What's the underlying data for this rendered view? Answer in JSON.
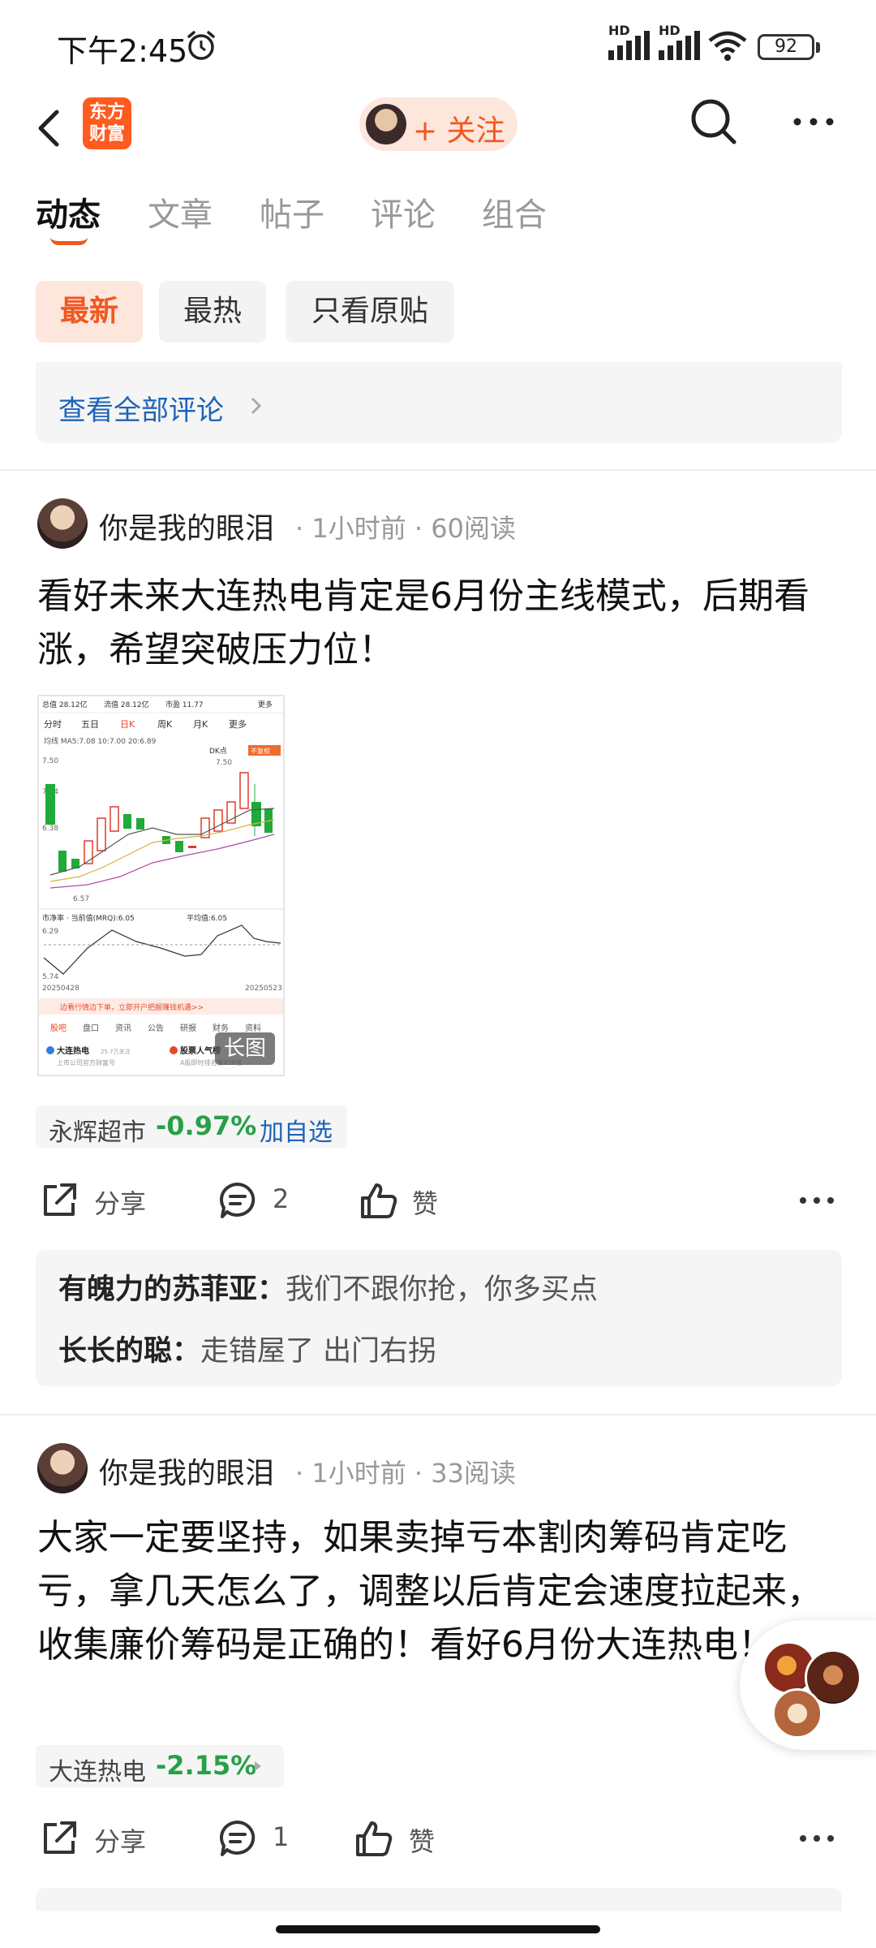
{
  "status_bar": {
    "time": "下午2:45",
    "signal1_label": "HD",
    "signal2_label": "HD",
    "battery": "92"
  },
  "nav": {
    "logo_line1": "东方",
    "logo_line2": "财富",
    "follow_label": "+ 关注"
  },
  "tabs": [
    {
      "label": "动态",
      "active": true
    },
    {
      "label": "文章"
    },
    {
      "label": "帖子"
    },
    {
      "label": "评论"
    },
    {
      "label": "组合"
    }
  ],
  "filters": [
    {
      "label": "最新",
      "active": true
    },
    {
      "label": "最热"
    },
    {
      "label": "只看原贴"
    }
  ],
  "prev_card": {
    "link": "查看全部评论"
  },
  "posts": [
    {
      "username": "你是我的眼泪",
      "time": "1小时前",
      "reads": "60阅读",
      "text": "看好未来大连热电肯定是6月份主线模式，后期看涨，希望突破压力位！",
      "image_badge": "长图",
      "stock": {
        "name": "永辉超市",
        "change": "-0.97%",
        "add": "加自选"
      },
      "share": "分享",
      "comments": "2",
      "like": "赞",
      "replies": [
        {
          "user": "有魄力的苏菲亚：",
          "text": "我们不跟你抢，你多买点"
        },
        {
          "user": "长长的聪：",
          "text": "走错屋了 出门右拐"
        }
      ]
    },
    {
      "username": "你是我的眼泪",
      "time": "1小时前",
      "reads": "33阅读",
      "text": "大家一定要坚持，如果卖掉亏本割肉筹码肯定吃亏，拿几天怎么了，调整以后肯定会速度拉起来，收集廉价筹码是正确的！看好6月份大连热电！",
      "stock": {
        "name": "大连热电",
        "change": "-2.15%"
      },
      "share": "分享",
      "comments": "1",
      "like": "赞"
    }
  ],
  "chart_thumb": {
    "header": [
      "总值 28.12亿",
      "流值 28.12亿",
      "市盈 11.77",
      "更多"
    ],
    "periods": [
      "分时",
      "五日",
      "日K",
      "周K",
      "月K",
      "更多"
    ],
    "ma_line": "均线 MA5:7.08 10:7.00 20:6.89",
    "tag_dk": "DK点",
    "tag_fuquan": "不复权",
    "y_high": "7.50",
    "y_low": "6.57",
    "y_mid1": "7.04",
    "y_mid2": "6.38",
    "pb_line": "市净率 · 当前值(MRQ):6.05",
    "pb_avg": "平均值:6.05",
    "pb_high": "6.29",
    "pb_low": "5.74",
    "date_start": "20250428",
    "date_end": "20250523",
    "banner": "边看行情边下单，立即开户把握赚钱机遇>>",
    "bottom_tabs": [
      "股吧",
      "盘口",
      "资讯",
      "公告",
      "研报",
      "财务",
      "资料"
    ],
    "card1_title": "大连热电",
    "card1_sub": "上市公司官方财富号",
    "card1_badge": "25.7万关注",
    "card2_title": "股票人气榜",
    "card2_sub": "A股即时排名第936名"
  },
  "colors": {
    "accent": "#f1571f",
    "link": "#1e63b8",
    "down": "#27a047"
  }
}
